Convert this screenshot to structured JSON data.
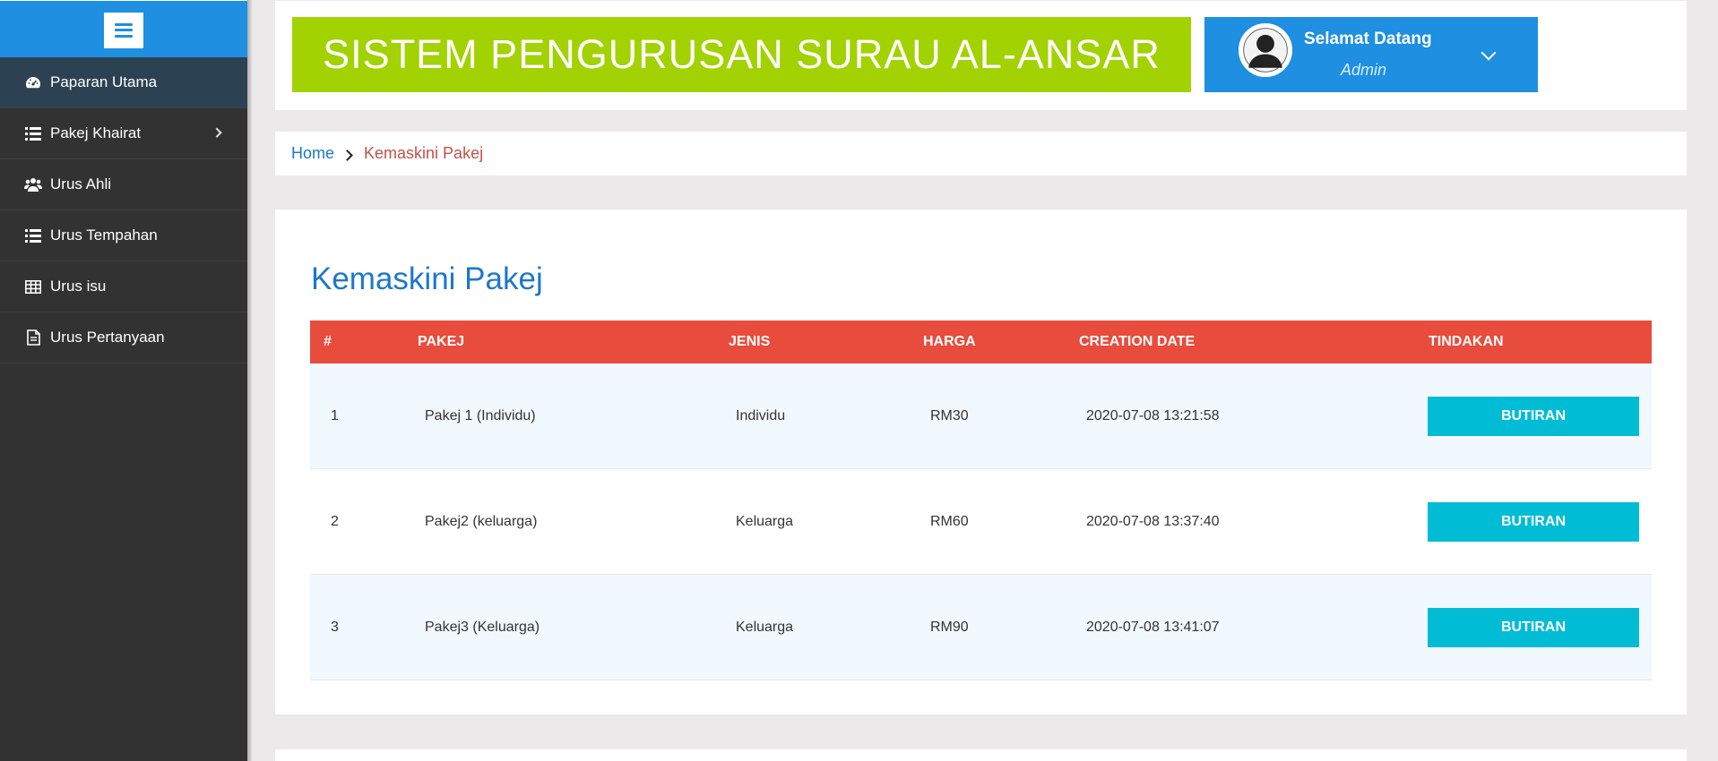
{
  "sidebar": {
    "items": [
      {
        "label": "Paparan Utama",
        "icon": "dashboard-icon",
        "active": true
      },
      {
        "label": "Pakej Khairat",
        "icon": "list-icon",
        "has_submenu": true
      },
      {
        "label": "Urus Ahli",
        "icon": "users-icon"
      },
      {
        "label": "Urus Tempahan",
        "icon": "list-icon"
      },
      {
        "label": "Urus isu",
        "icon": "table-icon"
      },
      {
        "label": "Urus Pertanyaan",
        "icon": "document-icon"
      }
    ]
  },
  "header": {
    "title": "SISTEM PENGURUSAN SURAU AL-ANSAR",
    "welcome": "Selamat Datang",
    "username": "Admin"
  },
  "breadcrumb": {
    "home": "Home",
    "current": "Kemaskini Pakej"
  },
  "main": {
    "title": "Kemaskini Pakej",
    "columns": [
      "#",
      "PAKEJ",
      "JENIS",
      "HARGA",
      "CREATION DATE",
      "TINDAKAN"
    ],
    "rows": [
      {
        "no": "1",
        "pakej": "Pakej 1 (Individu)",
        "jenis": "Individu",
        "harga": "RM30",
        "date": "2020-07-08 13:21:58",
        "action": "BUTIRAN"
      },
      {
        "no": "2",
        "pakej": "Pakej2 (keluarga)",
        "jenis": "Keluarga",
        "harga": "RM60",
        "date": "2020-07-08 13:37:40",
        "action": "BUTIRAN"
      },
      {
        "no": "3",
        "pakej": "Pakej3 (Keluarga)",
        "jenis": "Keluarga",
        "harga": "RM90",
        "date": "2020-07-08 13:41:07",
        "action": "BUTIRAN"
      }
    ]
  },
  "colors": {
    "primary": "#1e8fe1",
    "banner": "#a2d201",
    "table_header": "#e84c3d",
    "button": "#00bcd4",
    "sidebar": "#323232"
  }
}
